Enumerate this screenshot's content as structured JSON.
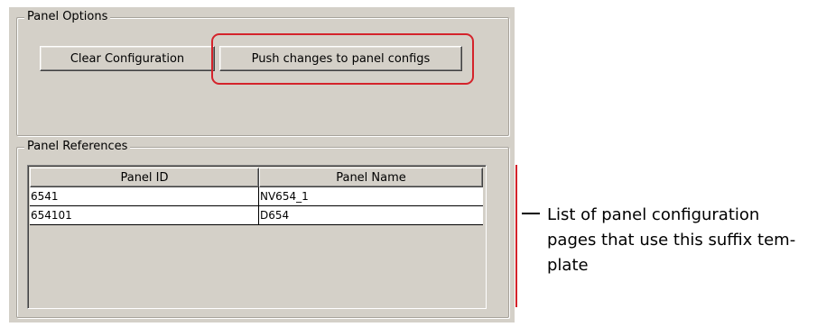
{
  "panel_options": {
    "legend": "Panel Options",
    "clear_button": "Clear Configuration",
    "push_button": "Push changes to panel configs"
  },
  "panel_references": {
    "legend": "Panel References",
    "columns": [
      "Panel ID",
      "Panel Name"
    ],
    "rows": [
      [
        "6541",
        "NV654_1"
      ],
      [
        "654101",
        "D654"
      ]
    ]
  },
  "callout": {
    "text": "List of panel configuration pages that use this suffix tem-plate",
    "lines": [
      "List of panel configuration",
      "pages that use this suffix tem-",
      "plate"
    ]
  },
  "colors": {
    "highlight": "#d4232b",
    "dialog_bg": "#d4d0c8"
  }
}
